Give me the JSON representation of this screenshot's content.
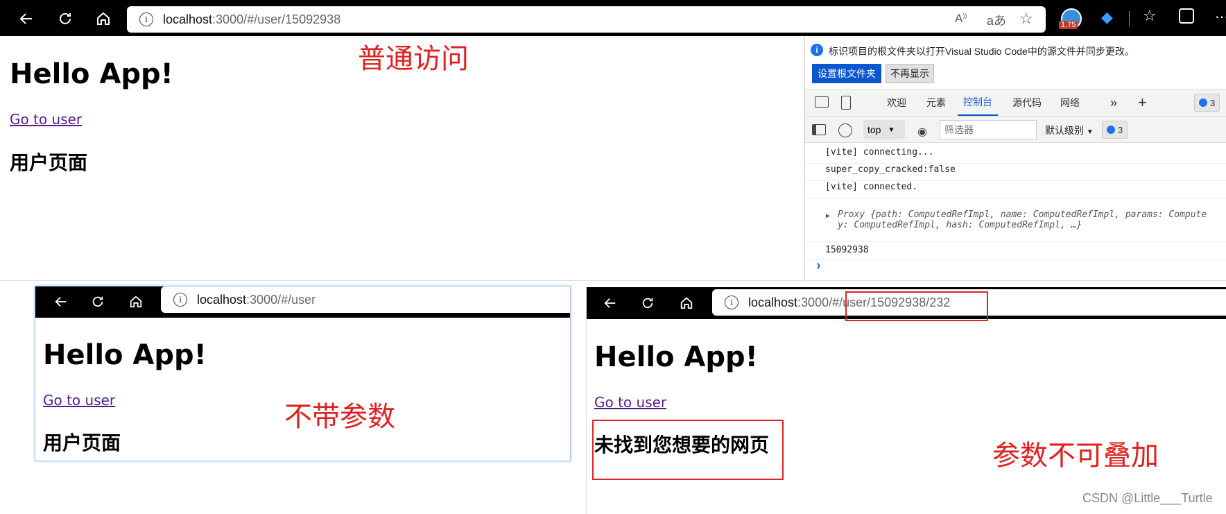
{
  "top_window": {
    "url_host": "localhost",
    "url_path": ":3000/#/user/15092938",
    "zoom_badge": "1.75",
    "heading": "Hello App!",
    "link": "Go to user",
    "subheading": "用户页面"
  },
  "annotations": {
    "normal_access": "普通访问",
    "no_params": "不带参数",
    "params_not_stackable": "参数不可叠加",
    "watermark": "CSDN @Little___Turtle"
  },
  "devtools": {
    "info_text": "标识项目的根文件夹以打开Visual Studio Code中的源文件并同步更改。",
    "btn_set_root": "设置根文件夹",
    "btn_dismiss": "不再显示",
    "tabs": [
      "欢迎",
      "元素",
      "控制台",
      "源代码",
      "网络"
    ],
    "active_tab": "控制台",
    "issues_count": "3",
    "context": "top",
    "filter_placeholder": "筛选器",
    "level": "默认级别",
    "console_count": "3",
    "logs": [
      "[vite] connecting...",
      "super_copy_cracked:false",
      "[vite] connected.",
      "15092938"
    ],
    "proxy_line1": "Proxy {path: ComputedRefImpl, name: ComputedRefImpl, params: Compute",
    "proxy_line2": "y: ComputedRefImpl, hash: ComputedRefImpl, …}",
    "prompt": "›"
  },
  "bottom_left_window": {
    "url_host": "localhost",
    "url_path": ":3000/#/user",
    "heading": "Hello App!",
    "link": "Go to user",
    "subheading": "用户页面"
  },
  "bottom_right_window": {
    "url_host": "localhost",
    "url_path": ":3000/#/user/15092938/232",
    "heading": "Hello App!",
    "link": "Go to user",
    "subheading": "未找到您想要的网页"
  },
  "colors": {
    "annotation_red": "#e02020",
    "devtools_accent": "#0b57d0",
    "link_visited": "#551a8b"
  }
}
